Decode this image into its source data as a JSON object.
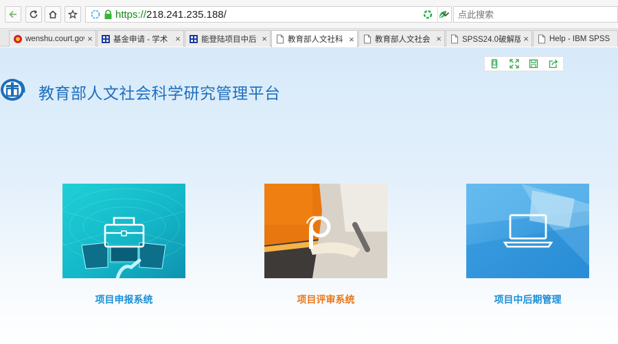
{
  "browser": {
    "url_scheme": "https://",
    "url_rest": "218.241.235.188/",
    "search_placeholder": "点此搜索",
    "tabs": [
      {
        "label": "wenshu.court.gov",
        "close": "×"
      },
      {
        "label": "基金申请 - 学术",
        "close": "×"
      },
      {
        "label": "能登陆项目中后",
        "close": "×"
      },
      {
        "label": "教育部人文社科",
        "close": "×"
      },
      {
        "label": "教育部人文社会",
        "close": "×"
      },
      {
        "label": "SPSS24.0破解版",
        "close": "×"
      },
      {
        "label": "Help - IBM SPSS",
        "close": "×"
      }
    ]
  },
  "page": {
    "title": "教育部人文社会科学研究管理平台",
    "cards": [
      {
        "label": "项目申报系统",
        "color": "#1a8fd6"
      },
      {
        "label": "项目评审系统",
        "color": "#e8771b"
      },
      {
        "label": "项目中后期管理",
        "color": "#1a8fd6"
      }
    ]
  }
}
